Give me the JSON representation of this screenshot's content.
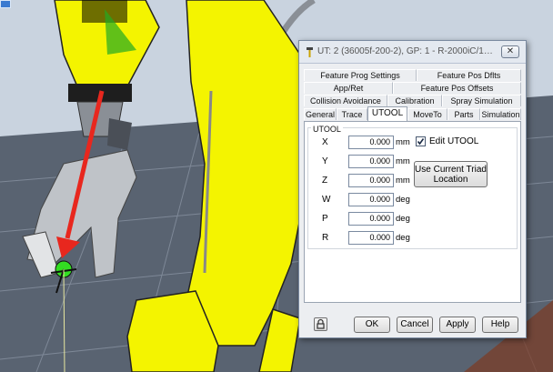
{
  "dialog": {
    "title": "UT: 2  (36005f-200-2), GP: 1 - R-2000iC/165F, Robo...",
    "close_label": "✕"
  },
  "tabs": {
    "row1": [
      "Feature Prog Settings",
      "Feature Pos Dflts"
    ],
    "row2": [
      "App/Ret",
      "Feature Pos Offsets"
    ],
    "row3": [
      "Collision Avoidance",
      "Calibration",
      "Spray Simulation"
    ],
    "row4": [
      "General",
      "Trace",
      "UTOOL",
      "MoveTo",
      "Parts",
      "Simulation"
    ],
    "active": "UTOOL"
  },
  "utool": {
    "group_label": "UTOOL",
    "fields": [
      {
        "label": "X",
        "value": "0.000",
        "unit": "mm"
      },
      {
        "label": "Y",
        "value": "0.000",
        "unit": "mm"
      },
      {
        "label": "Z",
        "value": "0.000",
        "unit": "mm"
      },
      {
        "label": "W",
        "value": "0.000",
        "unit": "deg"
      },
      {
        "label": "P",
        "value": "0.000",
        "unit": "deg"
      },
      {
        "label": "R",
        "value": "0.000",
        "unit": "deg"
      }
    ],
    "edit_checkbox_label": "Edit UTOOL",
    "edit_checked": true,
    "use_triad_line1": "Use Current Triad",
    "use_triad_line2": "Location"
  },
  "buttons": {
    "ok": "OK",
    "cancel": "Cancel",
    "apply": "Apply",
    "help": "Help"
  },
  "colors": {
    "robot_yellow": "#f4f400",
    "arrow_red": "#e8271e",
    "tcp_green": "#33dd22",
    "sky": "#c9d3df",
    "floor": "#5b6573"
  }
}
